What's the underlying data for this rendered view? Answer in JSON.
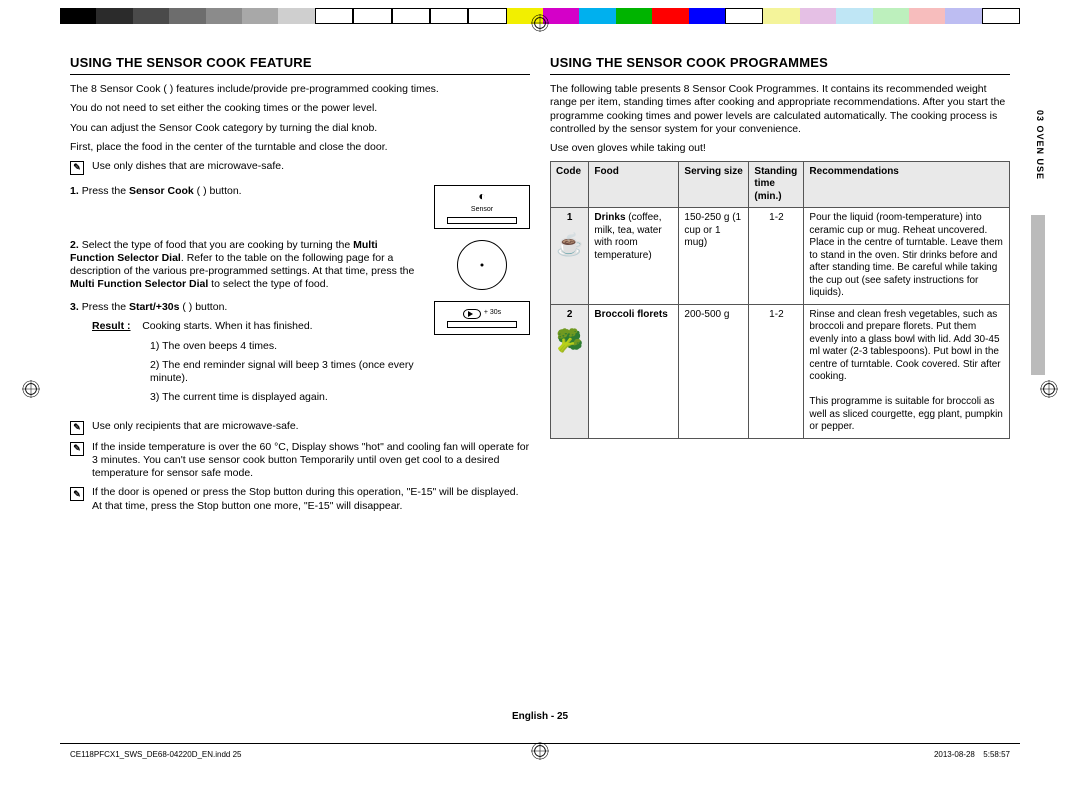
{
  "colorbar": [
    "#000",
    "#2b2b2b",
    "#4a4a4a",
    "#6d6d6d",
    "#8b8b8b",
    "#a8a8a8",
    "#cfcfcf",
    "#fff",
    "#fff",
    "#fff",
    "#fff",
    "#fff",
    "#f2ef00",
    "#d400c8",
    "#00b0ee",
    "#00b400",
    "#ff0000",
    "#0000ff",
    "#fff",
    "#f4f49a",
    "#e5c0e5",
    "#bfe6f5",
    "#bdf0bd",
    "#f7bdbd",
    "#bdbdf2",
    "#fff"
  ],
  "left": {
    "heading": "USING THE SENSOR COOK FEATURE",
    "intro1": "The 8 Sensor Cook (      ) features include/provide pre-programmed cooking times.",
    "intro2": "You do not need to set either the cooking times or the power level.",
    "intro3": "You can adjust the Sensor Cook category by turning the dial knob.",
    "intro4": "First, place the food in the center of the turntable and close the door.",
    "note1": "Use only dishes that are microwave-safe.",
    "step1_pre": "1.",
    "step1_a": "Press the ",
    "step1_bold": "Sensor Cook",
    "step1_b": " (      ) button.",
    "box1_label": "Sensor",
    "step2_pre": "2.",
    "step2_a": "Select the type of food that you are cooking by turning the ",
    "step2_bold1": "Multi Function Selector Dial",
    "step2_b": ". Refer to the table on the following page for a description of the various pre-programmed settings. At that time, press the ",
    "step2_bold2": "Multi Function Selector Dial",
    "step2_c": " to select the type of food.",
    "step3_pre": "3.",
    "step3_a": "Press the ",
    "step3_bold": "Start/+30s",
    "step3_b": " (   ) button.",
    "result_label": "Result :",
    "result_txt": "Cooking starts. When it has finished.",
    "r1": "1)  The oven beeps 4 times.",
    "r2": "2)  The end reminder signal will beep 3 times (once every minute).",
    "r3": "3)  The current time is displayed again.",
    "box3_label": "+ 30s",
    "note2": "Use only recipients that are microwave-safe.",
    "note3": "If the inside temperature is over the 60 °C, Display shows \"hot\" and cooling fan will operate for 3 minutes. You can't use sensor cook button Temporarily until oven get cool to a desired temperature for sensor safe mode.",
    "note4": "If the door is opened or press the Stop button during this operation, \"E-15\" will be displayed. At that time, press the Stop button one more, \"E-15\" will disappear."
  },
  "right": {
    "heading": "USING THE SENSOR COOK PROGRAMMES",
    "intro": "The following table presents 8 Sensor Cook Programmes. It contains its recommended weight range per item, standing times after cooking and appropriate recommendations. After you start the programme cooking times and power levels are calculated automatically. The cooking process is controlled by the sensor system for your convenience.",
    "gloves": "Use oven gloves while taking out!",
    "th_code": "Code",
    "th_food": "Food",
    "th_serving": "Serving size",
    "th_standing": "Standing time (min.)",
    "th_rec": "Recommendations",
    "rows": [
      {
        "code": "1",
        "food_b": "Drinks",
        "food_sub": "(coffee, milk, tea, water with room temperature)",
        "icon": "☕",
        "serv": "150-250 g (1 cup or 1 mug)",
        "stand": "1-2",
        "rec": "Pour the liquid (room-temperature) into ceramic cup or mug. Reheat uncovered. Place in the centre of turntable. Leave them to stand in the oven. Stir drinks before and after standing time. Be careful while taking the cup out (see safety instructions for liquids)."
      },
      {
        "code": "2",
        "food_b": "Broccoli florets",
        "food_sub": "",
        "icon": "🥦",
        "serv": "200-500 g",
        "stand": "1-2",
        "rec": "Rinse and clean fresh vegetables, such as broccoli and prepare florets. Put them evenly into a glass bowl with lid. Add 30-45 ml water (2-3 tablespoons). Put bowl in the centre of turntable. Cook covered. Stir after cooking.",
        "rec2": "This programme is suitable for broccoli as well as sliced courgette, egg plant, pumpkin or pepper."
      }
    ]
  },
  "sidebar": "03  OVEN USE",
  "footer": "English - 25",
  "meta_l": "CE118PFCX1_SWS_DE68-04220D_EN.indd   25",
  "meta_r": "2013-08-28     5:58:57"
}
